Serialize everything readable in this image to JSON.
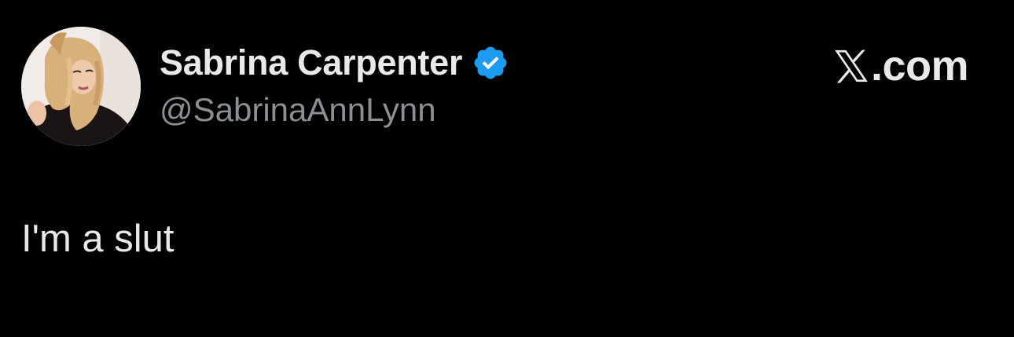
{
  "tweet": {
    "author": {
      "display_name": "Sabrina Carpenter",
      "handle": "@SabrinaAnnLynn",
      "verified": true,
      "avatar_icon": "profile-photo"
    },
    "text": "I'm a slut"
  },
  "brand": {
    "logo_icon": "x-logo-icon",
    "text": ".com"
  },
  "colors": {
    "background": "#000000",
    "primary_text": "#e7e9ea",
    "secondary_text": "#8b9095",
    "verified_blue": "#1d9bf0"
  }
}
